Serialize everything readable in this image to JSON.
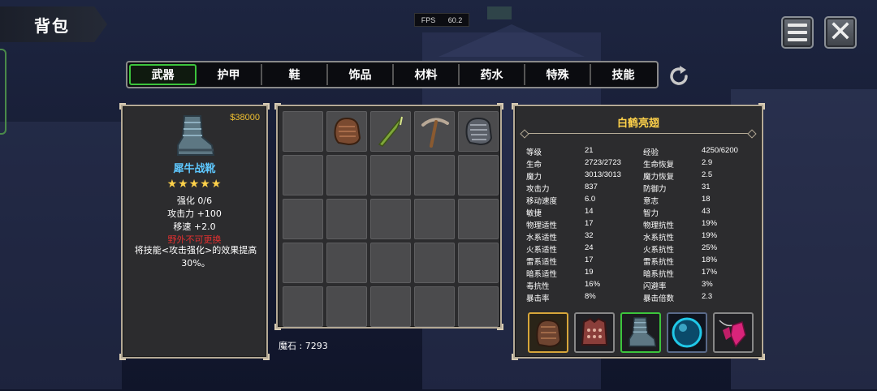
{
  "header": {
    "title": "背包",
    "fps_label": "FPS",
    "fps_value": "60.2"
  },
  "tabs": [
    "武器",
    "护甲",
    "鞋",
    "饰品",
    "材料",
    "药水",
    "特殊",
    "技能"
  ],
  "active_tab": "武器",
  "item_detail": {
    "price": "$38000",
    "name": "犀牛战靴",
    "stars": "★★★★★",
    "lines": [
      "强化 0/6",
      "攻击力  +100",
      "移速  +2.0"
    ],
    "warning": "野外不可更换",
    "description": "将技能<攻击强化>的效果提高30%。",
    "icon": "armored-boot-icon"
  },
  "inventory": {
    "items": [
      {
        "icon": "leather-gauntlet-icon"
      },
      {
        "icon": "green-spear-icon"
      },
      {
        "icon": "pickaxe-icon"
      },
      {
        "icon": "steel-gauntlet-icon"
      }
    ],
    "slot_count": 25,
    "gems_label": "魔石 : 7293"
  },
  "character": {
    "name": "白鹤亮翅",
    "stats": [
      [
        "等级",
        "21",
        "经验",
        "4250/6200"
      ],
      [
        "生命",
        "2723/2723",
        "生命恢复",
        "2.9"
      ],
      [
        "魔力",
        "3013/3013",
        "魔力恢复",
        "2.5"
      ],
      [
        "攻击力",
        "837",
        "防御力",
        "31"
      ],
      [
        "移动速度",
        "6.0",
        "意志",
        "18"
      ],
      [
        "敏捷",
        "14",
        "智力",
        "43"
      ],
      [
        "物理适性",
        "17",
        "物理抗性",
        "19%"
      ],
      [
        "水系适性",
        "32",
        "水系抗性",
        "19%"
      ],
      [
        "火系适性",
        "24",
        "火系抗性",
        "25%"
      ],
      [
        "雷系适性",
        "17",
        "雷系抗性",
        "18%"
      ],
      [
        "暗系适性",
        "19",
        "暗系抗性",
        "17%"
      ],
      [
        "毒抗性",
        "16%",
        "闪避率",
        "3%"
      ],
      [
        "暴击率",
        "8%",
        "暴击倍数",
        "2.3"
      ]
    ],
    "equipment": [
      {
        "icon": "brown-gauntlet-icon",
        "style": "gold"
      },
      {
        "icon": "chest-armor-icon",
        "style": "plain"
      },
      {
        "icon": "armored-boot-icon",
        "style": "sel"
      },
      {
        "icon": "blue-orb-icon",
        "style": "blue"
      },
      {
        "icon": "pink-crystal-necklace-icon",
        "style": "plain"
      }
    ]
  },
  "colors": {
    "accent_green": "#3cc43c",
    "price_gold": "#f0c030",
    "item_name_blue": "#5ec8ff",
    "warning_red": "#e03030",
    "char_name_gold": "#ffd24a"
  }
}
